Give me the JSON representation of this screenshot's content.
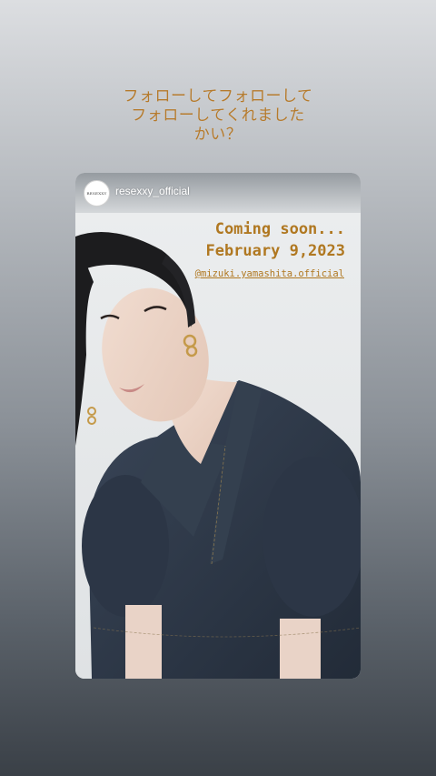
{
  "caption": {
    "line1": "フォローしてフォローして",
    "line2": "フォローしてくれました",
    "line3": "かい？"
  },
  "story": {
    "username": "resexxy_official",
    "avatar_text": "RESEXXY",
    "announcement": {
      "line1": "Coming soon...",
      "line2": "February 9,2023"
    },
    "mention": "@mizuki.yamashita.official"
  },
  "colors": {
    "accent_gold": "#b07821",
    "caption_gold": "#b57a2c"
  }
}
